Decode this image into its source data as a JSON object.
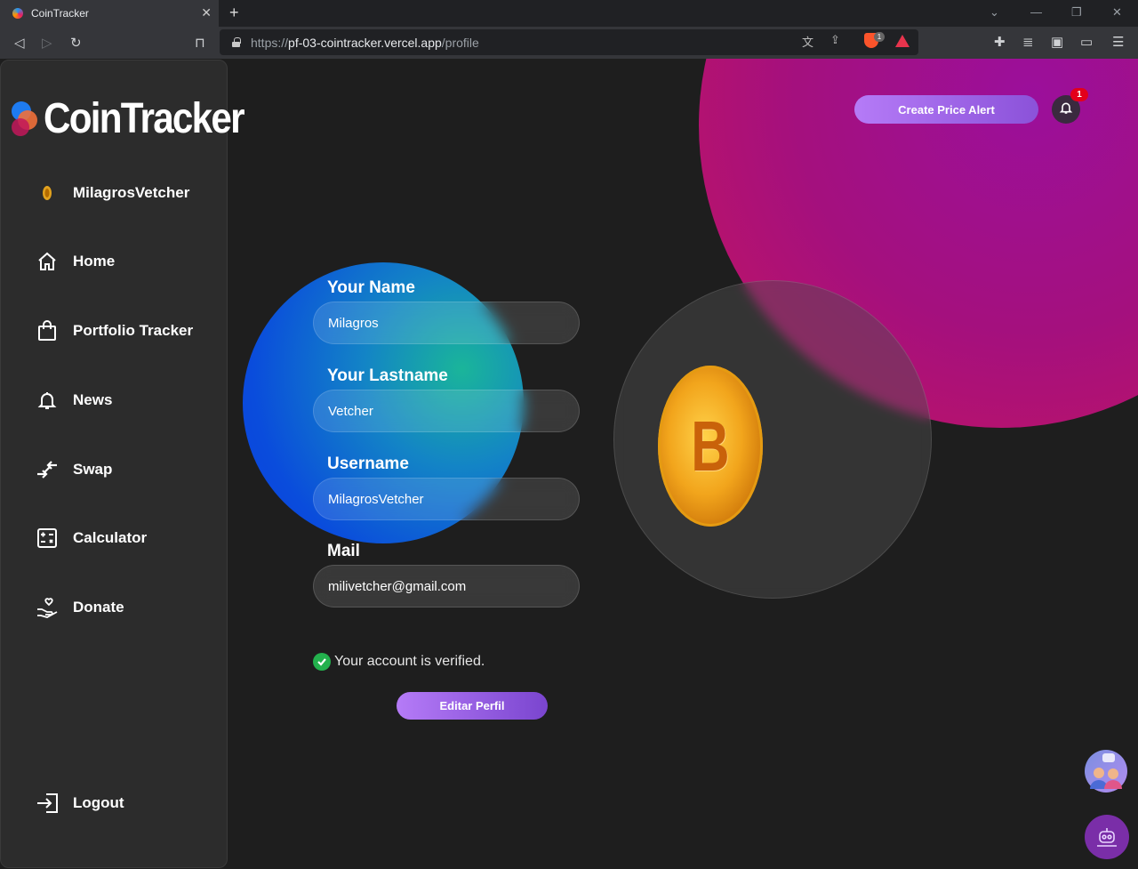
{
  "browser": {
    "tab_title": "CoinTracker",
    "url_scheme": "https://",
    "url_host": "pf-03-cointracker.vercel.app",
    "url_path": "/profile",
    "brave_badge": "1"
  },
  "sidebar": {
    "logo": "CoinTracker",
    "items": [
      {
        "label": "MilagrosVetcher",
        "icon": "user-coin-icon"
      },
      {
        "label": "Home",
        "icon": "home-icon"
      },
      {
        "label": "Portfolio Tracker",
        "icon": "bag-icon"
      },
      {
        "label": "News",
        "icon": "bell-icon"
      },
      {
        "label": "Swap",
        "icon": "swap-icon"
      },
      {
        "label": "Calculator",
        "icon": "calculator-icon"
      },
      {
        "label": "Donate",
        "icon": "donate-hand-icon"
      }
    ],
    "logout": "Logout"
  },
  "header": {
    "alert_button": "Create Price Alert",
    "notification_count": "1"
  },
  "form": {
    "name_label": "Your Name",
    "name_value": "Milagros",
    "lastname_label": "Your Lastname",
    "lastname_value": "Vetcher",
    "username_label": "Username",
    "username_value": "MilagrosVetcher",
    "mail_label": "Mail",
    "mail_value": "milivetcher@gmail.com",
    "verified_text": "Your account is verified.",
    "edit_button": "Editar Perfil"
  },
  "colors": {
    "accent": "#a36ae8",
    "verified": "#23b14d",
    "badge": "#e3001b"
  }
}
